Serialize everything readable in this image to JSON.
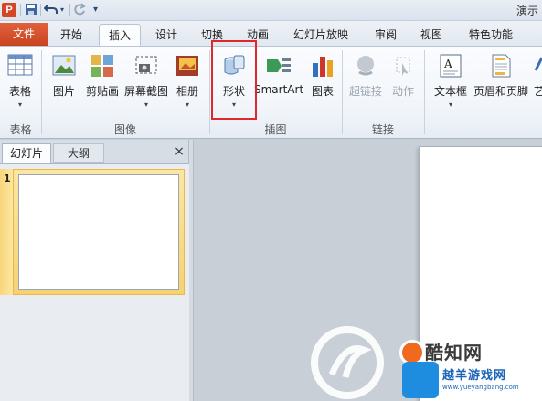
{
  "titlebar": {
    "app_icon": "P",
    "title": "演示"
  },
  "tabs": {
    "file": "文件",
    "items": [
      "开始",
      "插入",
      "设计",
      "切换",
      "动画",
      "幻灯片放映",
      "审阅",
      "视图",
      "特色功能"
    ],
    "active": "插入"
  },
  "ribbon": {
    "table": "表格",
    "picture": "图片",
    "clipart": "剪贴画",
    "screenshot": "屏幕截图",
    "album": "相册",
    "shapes": "形状",
    "smartart": "SmartArt",
    "chart": "图表",
    "hyperlink": "超链接",
    "action": "动作",
    "textbox": "文本框",
    "header_footer": "页眉和页脚",
    "wordart": "艺",
    "groups": {
      "tables": "表格",
      "images": "图像",
      "illustrations": "插图",
      "links": "链接"
    },
    "arrow": "▾"
  },
  "panel": {
    "tab_slides": "幻灯片",
    "tab_outline": "大纲",
    "close": "×",
    "slide_number": "1"
  },
  "watermark": {
    "site_name": "酷知网",
    "site_name2": "越羊游戏网",
    "site_url": "www.yueyangbang.com"
  },
  "colors": {
    "file_tab": "#d24726",
    "highlight_box": "#e0272b",
    "slide_selected": "#f6d271"
  }
}
